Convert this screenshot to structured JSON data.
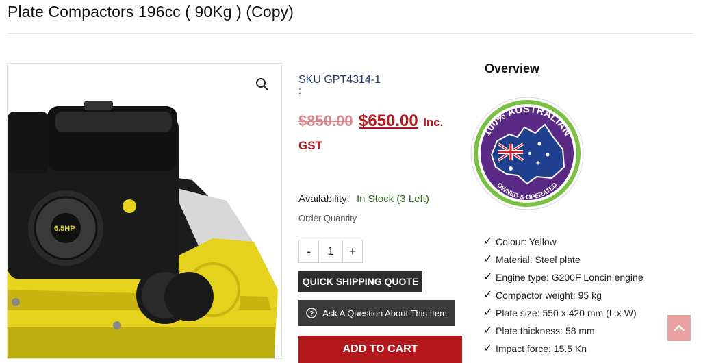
{
  "product": {
    "title": "Plate Compactors 196cc ( 90Kg ) (Copy)",
    "sku_label": "SKU",
    "sku": "GPT4314-1",
    "sku_colon": ":",
    "old_price": "$850.00",
    "new_price": "$650.00",
    "price_suffix": "Inc.",
    "gst": "GST",
    "engine_label": "6.5HP"
  },
  "availability": {
    "label": "Availability:",
    "status": "In Stock (3 Left)"
  },
  "order": {
    "label": "Order Quantity",
    "decrement": "-",
    "quantity": "1",
    "increment": "+"
  },
  "buttons": {
    "quick_quote": "QUICK SHIPPING QUOTE",
    "ask_question": "Ask A Question About This Item",
    "add_to_cart": "ADD TO CART"
  },
  "overview": {
    "title": "Overview",
    "badge_text_top": "100% AUSTRALIAN",
    "badge_text_bottom": "OWNED & OPERATED",
    "features": [
      "Colour: Yellow",
      "Material: Steel plate",
      "Engine type: G200F Loncin engine",
      "Compactor weight: 95 kg",
      "Plate size: 550 x 420 mm (L x W)",
      "Plate thickness: 58 mm",
      "Impact force: 15.5 Kn"
    ]
  },
  "icons": {
    "zoom": "magnifier-icon",
    "question": "question-circle-icon",
    "back_to_top": "chevron-up-icon",
    "check": "checkmark-icon"
  },
  "colors": {
    "price_red": "#b3181d",
    "stock_green": "#2e6b1f",
    "button_dark": "#2e2e2e",
    "badge_purple": "#5b2a86",
    "badge_green": "#7ac043",
    "compactor_yellow": "#e5d21d"
  }
}
